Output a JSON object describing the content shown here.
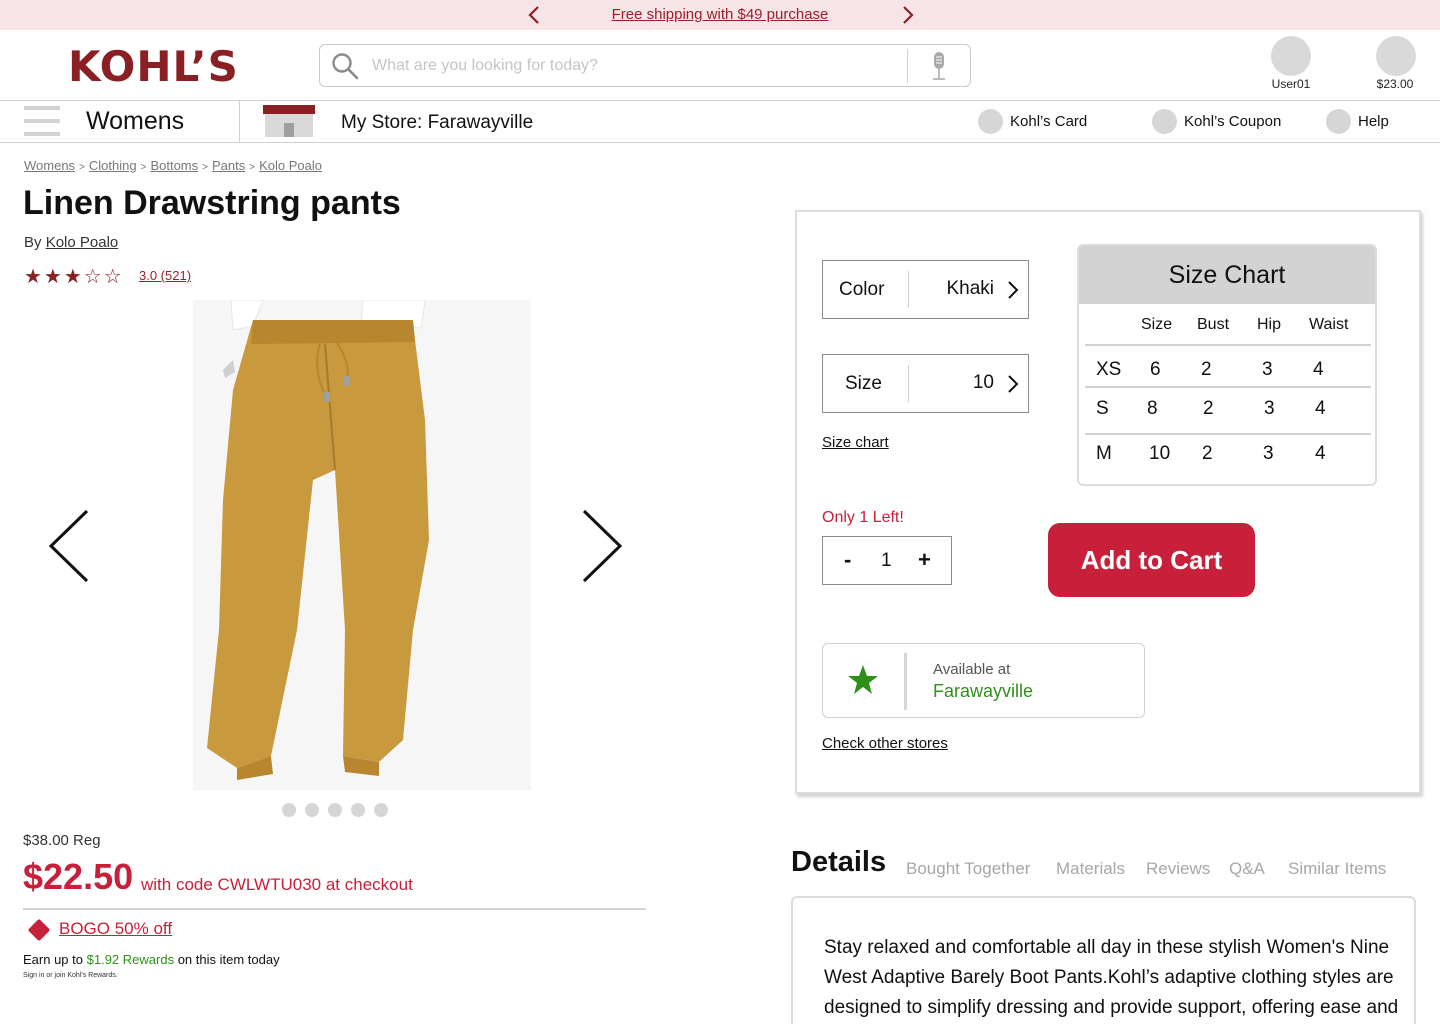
{
  "promo": {
    "text": "Free shipping with $49 purchase"
  },
  "header": {
    "logo": "KOHL’S",
    "search_placeholder": "What are you looking for today?",
    "user_label": "User01",
    "cart_total": "$23.00"
  },
  "nav": {
    "category": "Womens",
    "store": "My Store: Farawayville",
    "links": [
      "Kohl’s Card",
      "Kohl’s Coupon",
      "Help"
    ]
  },
  "breadcrumb": [
    "Womens",
    "Clothing",
    "Bottoms",
    "Pants",
    "Kolo Poalo"
  ],
  "product": {
    "title": "Linen Drawstring pants",
    "by_prefix": "By",
    "brand": "Kolo Poalo",
    "stars": "★★★☆☆",
    "rating_value": 3.0,
    "rating_text": "3.0 (521)",
    "image_count": 5,
    "active_image": 1,
    "regular_price": "$38.00 Reg",
    "sale_price": "$22.50",
    "sale_note": "with code CWLWTU030 at checkout",
    "bogo": "BOGO 50% off",
    "earn_prefix": "Earn up to",
    "rewards_amount": "$1.92 Rewards",
    "earn_suffix": "on this item today",
    "signin_note": "Sign in or join Kohl's Rewards."
  },
  "options": {
    "color_label": "Color",
    "color_value": "Khaki",
    "size_label": "Size",
    "size_value": "10",
    "size_chart_link": "Size chart",
    "stock_note": "Only 1 Left!",
    "qty_minus": "-",
    "quantity": "1",
    "qty_plus": "+",
    "add_to_cart": "Add to Cart",
    "available_at": "Available at",
    "available_store": "Farawayville",
    "check_other_stores": "Check other stores"
  },
  "size_chart": {
    "title": "Size Chart",
    "columns": [
      "Size",
      "Bust",
      "Hip",
      "Waist"
    ],
    "rows": [
      {
        "label": "XS",
        "values": [
          "6",
          "2",
          "3",
          "4"
        ]
      },
      {
        "label": "S",
        "values": [
          "8",
          "2",
          "3",
          "4"
        ]
      },
      {
        "label": "M",
        "values": [
          "10",
          "2",
          "3",
          "4"
        ]
      }
    ]
  },
  "details": {
    "title": "Details",
    "tabs": [
      "Bought Together",
      "Materials",
      "Reviews",
      "Q&A",
      "Similar Items"
    ],
    "text": "Stay relaxed and comfortable all day in these stylish Women's Nine West Adaptive Barely Boot Pants.Kohl’s adaptive clothing styles are designed to simplify dressing and provide support, offering ease and"
  },
  "colors": {
    "brand": "#8a1f24",
    "accent_red": "#c8203a",
    "green": "#2f8f1a",
    "promo_bg": "#f7e4e6",
    "pants": "#c9993e"
  }
}
